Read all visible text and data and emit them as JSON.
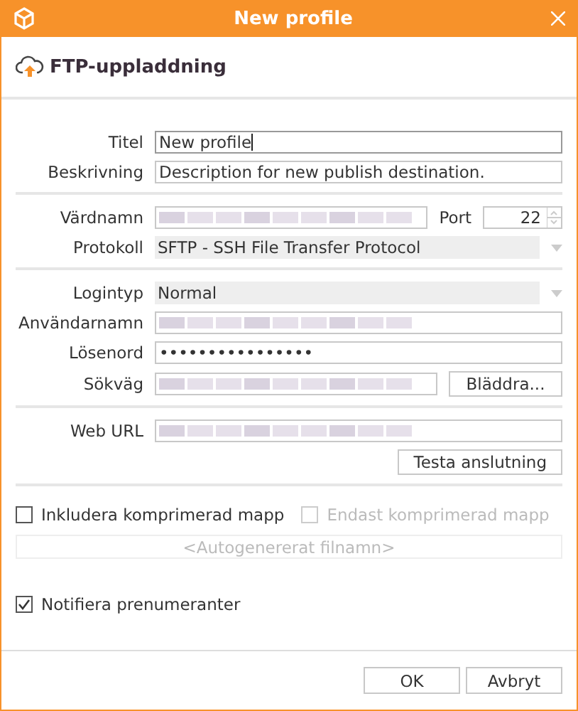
{
  "window": {
    "title": "New profile"
  },
  "header": {
    "title": "FTP-uppladdning"
  },
  "sections": [
    {
      "rows": [
        {
          "kind": "text",
          "label": "Titel",
          "value": "New profile",
          "focused": true
        },
        {
          "kind": "text",
          "label": "Beskrivning",
          "value": "Description for new publish destination.",
          "focused": false
        }
      ]
    },
    {
      "rows": [
        {
          "kind": "host",
          "label": "Värdnamn",
          "redacted": true,
          "port_label": "Port",
          "port": "22"
        },
        {
          "kind": "combo",
          "label": "Protokoll",
          "value": "SFTP - SSH File Transfer Protocol"
        }
      ]
    },
    {
      "rows": [
        {
          "kind": "combo",
          "label": "Logintyp",
          "value": "Normal"
        },
        {
          "kind": "text",
          "label": "Användarnamn",
          "redacted": true,
          "focused": false
        },
        {
          "kind": "text",
          "label": "Lösenord",
          "value": "••••••••••••••••",
          "focused": false
        },
        {
          "kind": "browse",
          "label": "Sökväg",
          "redacted": true,
          "button": "Bläddra..."
        }
      ]
    },
    {
      "rows": [
        {
          "kind": "text",
          "label": "Web URL",
          "redacted": true,
          "focused": false
        },
        {
          "kind": "button",
          "button": "Testa anslutning"
        }
      ]
    }
  ],
  "archive": {
    "options": [
      {
        "label": "Inkludera komprimerad mapp",
        "checked": false,
        "disabled": false
      },
      {
        "label": "Endast komprimerad mapp",
        "checked": false,
        "disabled": true
      }
    ],
    "filename": {
      "placeholder": "<Autogenererat filnamn>",
      "disabled": true
    }
  },
  "notify": {
    "label": "Notifiera prenumeranter",
    "checked": true
  },
  "buttons": [
    "OK",
    "Avbryt"
  ]
}
